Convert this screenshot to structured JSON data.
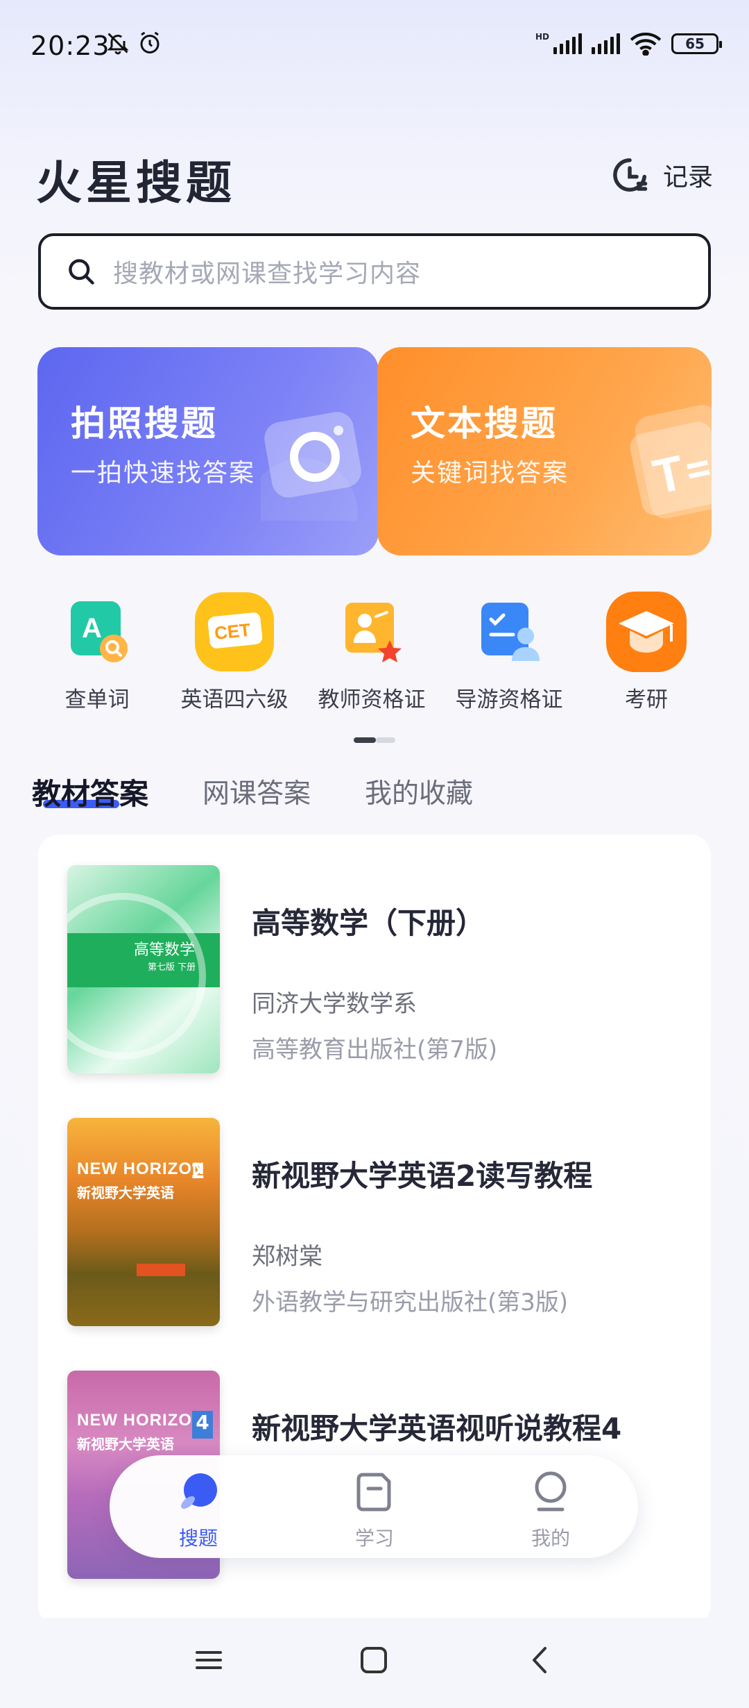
{
  "status_bar": {
    "time": "20:23",
    "battery": "65",
    "hd": "HD"
  },
  "header": {
    "title": "火星搜题",
    "history_label": "记录"
  },
  "search": {
    "placeholder": "搜教材或网课查找学习内容"
  },
  "feature_cards": [
    {
      "title": "拍照搜题",
      "subtitle": "一拍快速找答案",
      "icon": "camera-icon"
    },
    {
      "title": "文本搜题",
      "subtitle": "关键词找答案",
      "icon": "text-folder-icon"
    }
  ],
  "shortcuts": [
    {
      "label": "查单词",
      "icon": "word-lookup-icon"
    },
    {
      "label": "英语四六级",
      "icon": "cet-icon",
      "badge": "CET"
    },
    {
      "label": "教师资格证",
      "icon": "teacher-cert-icon"
    },
    {
      "label": "导游资格证",
      "icon": "tour-guide-cert-icon"
    },
    {
      "label": "考研",
      "icon": "graduate-cap-icon"
    }
  ],
  "tabs": [
    {
      "label": "教材答案",
      "active": true
    },
    {
      "label": "网课答案",
      "active": false
    },
    {
      "label": "我的收藏",
      "active": false
    }
  ],
  "books": [
    {
      "title": "高等数学（下册）",
      "author": "同济大学数学系",
      "publisher": "高等教育出版社(第7版)",
      "cover_title": "高等数学",
      "cover_sub": "第七版 下册"
    },
    {
      "title": "新视野大学英语2读写教程",
      "author": "郑树棠",
      "publisher": "外语教学与研究出版社(第3版)",
      "cover_title": "NEW HORIZON",
      "cover_sub": "新视野大学英语"
    },
    {
      "title": "新视野大学英语视听说教程4",
      "author": "",
      "publisher": "",
      "cover_title": "NEW HORIZON",
      "cover_sub": "新视野大学英语"
    }
  ],
  "bottom_nav": [
    {
      "label": "搜题",
      "active": true,
      "icon": "search-tab-icon"
    },
    {
      "label": "学习",
      "active": false,
      "icon": "study-tab-icon"
    },
    {
      "label": "我的",
      "active": false,
      "icon": "profile-tab-icon"
    }
  ],
  "colors": {
    "accent": "#3a5cf4",
    "photo_card": "#6870f2",
    "text_card": "#ff9a3a"
  }
}
